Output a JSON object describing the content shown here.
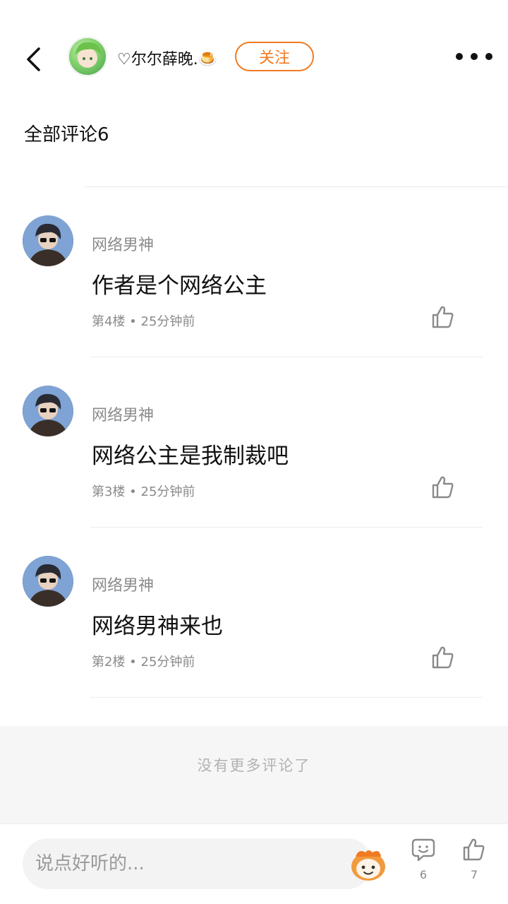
{
  "header": {
    "author_name": "♡尔尔薛晚.🍮",
    "follow_label": "关注",
    "back_icon": "chevron-left-icon",
    "more_icon": "more-horizontal-icon"
  },
  "comments_section": {
    "title": "全部评论6"
  },
  "comments": [
    {
      "user": "网络男神",
      "text": "作者是个网络公主",
      "meta": "第4楼 • 25分钟前"
    },
    {
      "user": "网络男神",
      "text": "网络公主是我制裁吧",
      "meta": "第3楼 • 25分钟前"
    },
    {
      "user": "网络男神",
      "text": "网络男神来也",
      "meta": "第2楼 • 25分钟前"
    }
  ],
  "footer": {
    "no_more_text": "没有更多评论了"
  },
  "bottombar": {
    "input_placeholder": "说点好听的...",
    "comment_count": "6",
    "like_count": "7"
  },
  "colors": {
    "accent": "#f07b22",
    "muted_text": "#8a8a8a",
    "divider": "#ececec"
  }
}
